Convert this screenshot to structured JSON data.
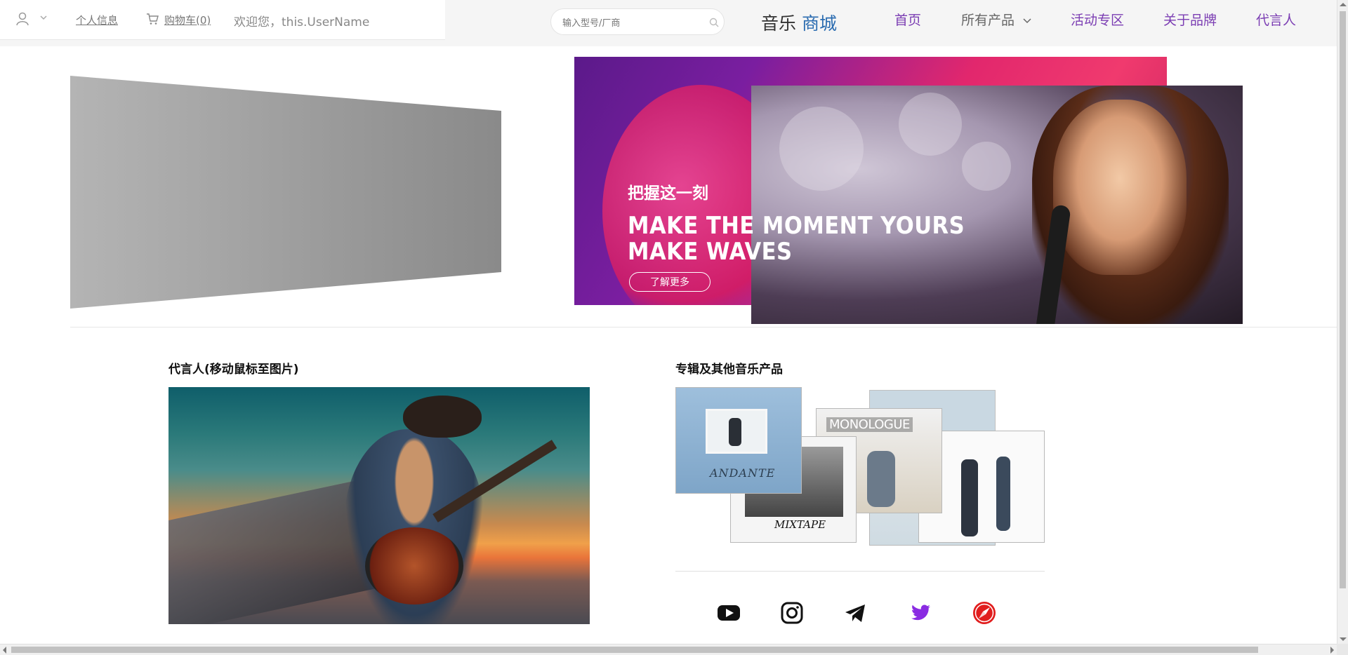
{
  "user_bar": {
    "profile_link": "个人信息",
    "cart_link": "购物车(0)",
    "welcome": "欢迎您，this.UserName"
  },
  "search": {
    "placeholder": "输入型号/厂商"
  },
  "brand": {
    "part1": "音乐",
    "part2": "商城"
  },
  "nav": {
    "home": "首页",
    "products": "所有产品",
    "events": "活动专区",
    "about": "关于品牌",
    "endorsers": "代言人"
  },
  "banner": {
    "headline_cn": "把握这一刻",
    "headline_en_1": "MAKE THE MOMENT YOURS",
    "headline_en_2": "MAKE WAVES",
    "cta": "了解更多"
  },
  "sections": {
    "endorser_title": "代言人(移动鼠标至图片)",
    "albums_title": "专辑及其他音乐产品"
  },
  "albums": [
    {
      "title": "ANDANTE"
    },
    {
      "title": "MIXTAPE"
    },
    {
      "title": "MONOLOGUE"
    },
    {
      "title": ""
    },
    {
      "title": ""
    }
  ],
  "social": [
    "youtube-icon",
    "instagram-icon",
    "telegram-icon",
    "twitter-icon",
    "safari-icon"
  ],
  "colors": {
    "nav_accent": "#7b3db3",
    "brand_accent": "#2b6cb0",
    "twitter": "#8a2be2",
    "safari": "#e11d1d"
  }
}
